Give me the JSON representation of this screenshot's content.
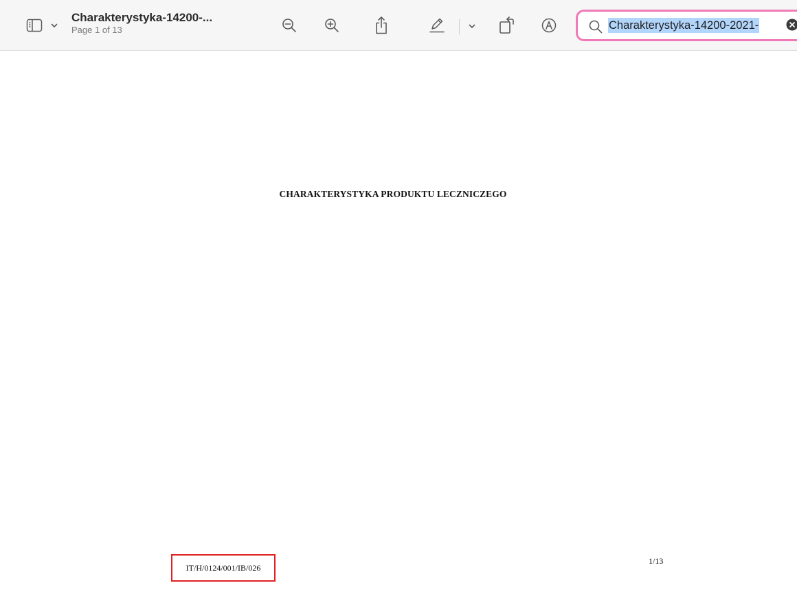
{
  "toolbar": {
    "document_title": "Charakterystyka-14200-...",
    "page_indicator": "Page 1 of 13",
    "search": {
      "value": "Charakterystyka-14200-2021-"
    },
    "icons": [
      "sidebar-toggle-icon",
      "chevron-down-icon",
      "zoom-out-icon",
      "zoom-in-icon",
      "share-icon",
      "markup-pen-icon",
      "chevron-down-icon",
      "rotate-icon",
      "markup-toolbar-icon",
      "search-icon",
      "clear-search-icon"
    ]
  },
  "document": {
    "heading": "CHARAKTERYSTYKA PRODUKTU LECZNICZEGO",
    "code": "IT/H/0124/001/IB/026",
    "page_number": "1/13"
  },
  "colors": {
    "toolbar_background": "#f6f6f6",
    "search_highlight_border": "#f07ab8",
    "text_selection": "#b2d5fb",
    "annotation_border": "#e02020"
  }
}
